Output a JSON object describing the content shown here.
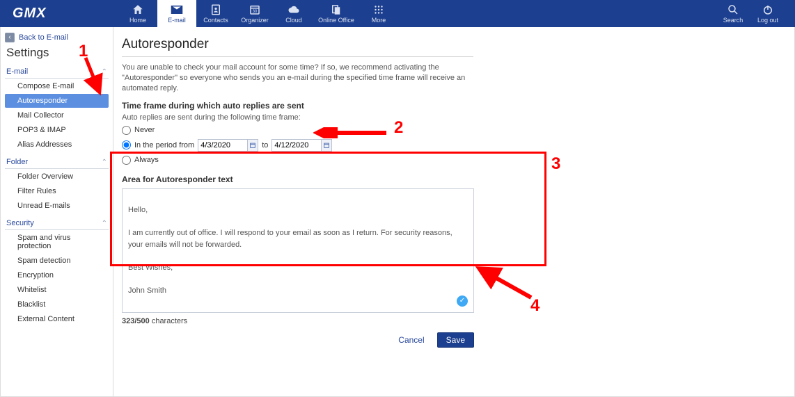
{
  "brand": "GMX",
  "nav": {
    "home": "Home",
    "email": "E-mail",
    "contacts": "Contacts",
    "organizer": "Organizer",
    "cloud": "Cloud",
    "online_office": "Online Office",
    "more": "More",
    "search": "Search",
    "logout": "Log out"
  },
  "sidebar": {
    "back": "Back to E-mail",
    "title": "Settings",
    "sections": {
      "email": {
        "label": "E-mail",
        "items": [
          "Compose E-mail",
          "Autoresponder",
          "Mail Collector",
          "POP3 & IMAP",
          "Alias Addresses"
        ]
      },
      "folder": {
        "label": "Folder",
        "items": [
          "Folder Overview",
          "Filter Rules",
          "Unread E-mails"
        ]
      },
      "security": {
        "label": "Security",
        "items": [
          "Spam and virus protection",
          "Spam detection",
          "Encryption",
          "Whitelist",
          "Blacklist",
          "External Content"
        ]
      }
    }
  },
  "page": {
    "title": "Autoresponder",
    "intro": "You are unable to check your mail account for some time? If so, we recommend activating the \"Autoresponder\" so everyone who sends you an e-mail during the specified time frame will receive an automated reply.",
    "timeframe_title": "Time frame during which auto replies are sent",
    "timeframe_sub": "Auto replies are sent during the following time frame:",
    "opt_never": "Never",
    "opt_period_prefix": "In the period from",
    "opt_period_to": "to",
    "date_from": "4/3/2020",
    "date_to": "4/12/2020",
    "opt_always": "Always",
    "text_label": "Area for Autoresponder text",
    "text_body": "Hello,\n\nI am currently out of office. I will respond to your email as soon as I return. For security reasons, your emails will not be forwarded.\n\nBest Wishes,\n\nJohn Smith",
    "char_count_num": "323/500",
    "char_count_suffix": " characters",
    "cancel": "Cancel",
    "save": "Save"
  },
  "annotations": {
    "a1": "1",
    "a2": "2",
    "a3": "3",
    "a4": "4"
  }
}
